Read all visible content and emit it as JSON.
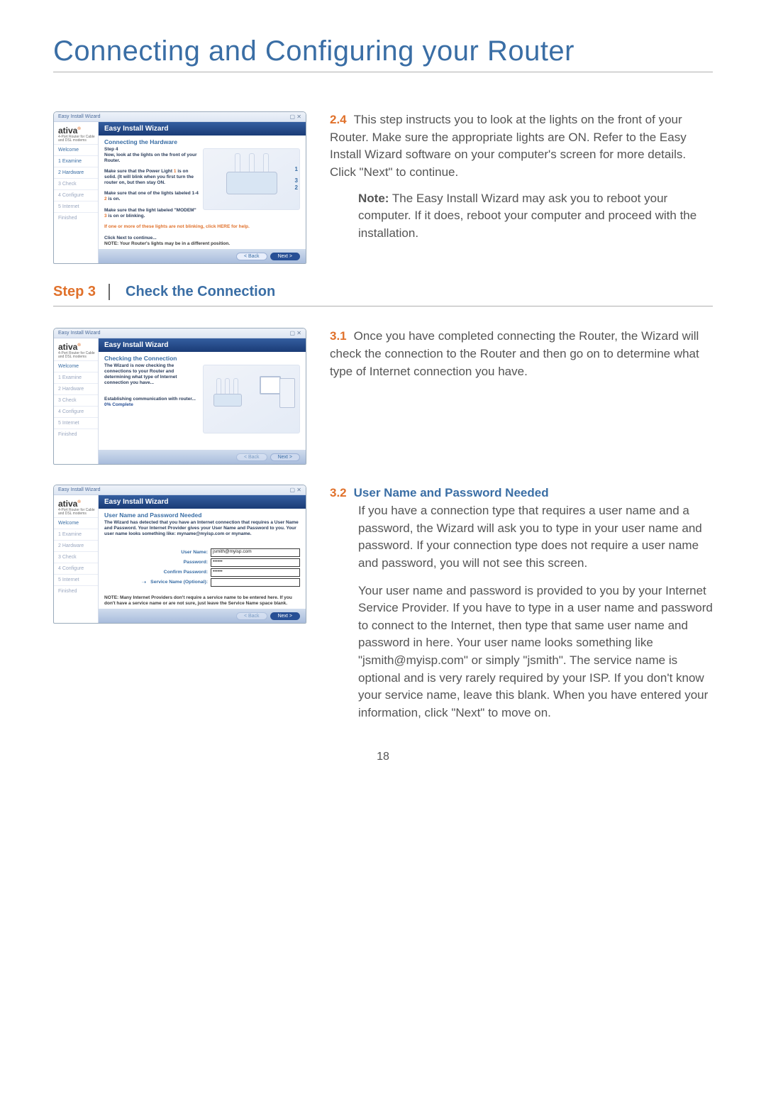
{
  "title": "Connecting and Configuring your Router",
  "page_number": "18",
  "s24_num": "2.4",
  "s24_text": "This step instructs you to look at the lights on the front of your Router. Make sure the appropriate lights are ON. Refer to the Easy Install Wizard software on your computer's screen for more details. Click \"Next\" to continue.",
  "s24_note_label": "Note:",
  "s24_note": " The Easy Install Wizard may ask you to reboot your computer. If it does, reboot your computer and proceed with the installation.",
  "step3_label": "Step 3",
  "step3_title": "Check the Connection",
  "s31_num": "3.1",
  "s31_text": "Once you have completed connecting the Router, the Wizard will check the connection to the Router and then go on to determine what type of Internet connection you have.",
  "s32_num": "3.2",
  "s32_head": "User Name and Password Needed",
  "s32_p1": "If you have a connection type that requires a user name and a password, the Wizard will ask you to type in your user name and password. If your connection type does not require a user name and password, you will not see this screen.",
  "s32_p2": "Your user name and password is provided to you by your Internet Service Provider. If you have to type in a user name and password to connect to the Internet, then type that same user name and password in here. Your user name looks something like \"jsmith@myisp.com\" or simply \"jsmith\". The service name is optional and is very rarely required by your ISP. If you don't know your service name, leave this blank. When you have entered your information, click \"Next\" to move on.",
  "wiz": {
    "window_title": "Easy Install Wizard",
    "logo": "ativa",
    "subtitle": "4-Port Router for Cable and DSL modems",
    "nav": [
      "Welcome",
      "1 Examine",
      "2 Hardware",
      "3 Check",
      "4 Configure",
      "5 Internet",
      "Finished"
    ],
    "header": "Easy Install Wizard",
    "back": "< Back",
    "next": "Next >",
    "a": {
      "sub": "Connecting the Hardware",
      "step": "Step 4",
      "l1": "Now, look at the lights on the front of your Router.",
      "l2a": "Make sure that the Power Light ",
      "l2b": " is on solid. (It will blink when you first turn the router on, but then stay ON.",
      "l3a": "Make sure that one of the lights labeled 1-4 ",
      "l3b": " is on.",
      "l4a": "Make sure that the light labeled \"MODEM\" ",
      "l4b": " is on or blinking.",
      "l5a": "If one or more of these lights are not blinking, click ",
      "l5b": "HERE",
      "l5c": " for help.",
      "l6": "Click Next to continue...",
      "foot": "NOTE: Your Router's lights may be in a different position.",
      "m1": "1",
      "m2": "2",
      "m3": "3"
    },
    "b": {
      "sub": "Checking the Connection",
      "t1": "The Wizard is now checking the connections to your Router and determining what type of Internet connection you have...",
      "t2": "Establishing communication with router...",
      "t3": "0% Complete"
    },
    "c": {
      "sub": "User Name and Password Needed",
      "t1": "The Wizard has detected that you have an Internet connection that requires a User Name and Password. Your Internet Provider gives your User Name and Password to you. Your user name looks something like: myname@myisp.com or myname.",
      "lbl_user": "User Name:",
      "val_user": "jsmith@myisp.com",
      "lbl_pw": "Password:",
      "lbl_cpw": "Confirm Password:",
      "lbl_sn": "Service Name (Optional):",
      "foot": "NOTE: Many Internet Providers don't require a service name to be entered here. If you don't have a service name or are not sure, just leave the Service Name space blank."
    }
  }
}
